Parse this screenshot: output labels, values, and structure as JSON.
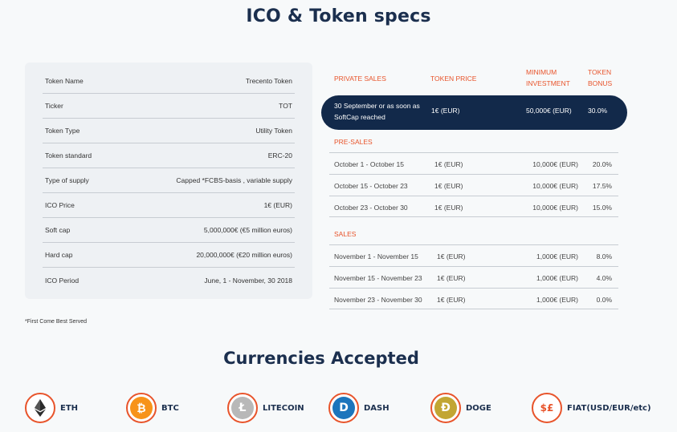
{
  "page": {
    "title": "ICO & Token specs"
  },
  "specs": [
    {
      "label": "Token Name",
      "value": "Trecento Token"
    },
    {
      "label": "Ticker",
      "value": "TOT"
    },
    {
      "label": "Token Type",
      "value": "Utility Token"
    },
    {
      "label": "Token standard",
      "value": "ERC-20"
    },
    {
      "label": "Type of supply",
      "value": "Capped *FCBS-basis , variable supply"
    },
    {
      "label": "ICO Price",
      "value": "1€ (EUR)"
    },
    {
      "label": "Soft cap",
      "value": "5,000,000€ (€5 million euros)"
    },
    {
      "label": "Hard cap",
      "value": "20,000,000€ (€20 million euros)"
    },
    {
      "label": "ICO Period",
      "value": "June, 1 - November, 30 2018"
    }
  ],
  "footnote": "*First Come Best Served",
  "pricing": {
    "headers": {
      "col1": "PRIVATE SALES",
      "col2": "TOKEN PRICE",
      "col3a": "MINIMUM",
      "col3b": "INVESTMENT",
      "col4a": "TOKEN",
      "col4b": "BONUS"
    },
    "private": {
      "period_line1": "30 September or as soon as",
      "period_line2": "SoftCap reached",
      "price": "1€ (EUR)",
      "min": "50,000€ (EUR)",
      "bonus": "30.0%"
    },
    "presales_label": "PRE-SALES",
    "presales": [
      {
        "period": "October 1 - October 15",
        "price": "1€ (EUR)",
        "min": "10,000€ (EUR)",
        "bonus": "20.0%"
      },
      {
        "period": "October 15 - October 23",
        "price": "1€ (EUR)",
        "min": "10,000€ (EUR)",
        "bonus": "17.5%"
      },
      {
        "period": "October 23 - October 30",
        "price": "1€ (EUR)",
        "min": "10,000€ (EUR)",
        "bonus": "15.0%"
      }
    ],
    "sales_label": "SALES",
    "sales": [
      {
        "period": "November 1 - November 15",
        "price": "1€ (EUR)",
        "min": "1,000€ (EUR)",
        "bonus": "8.0%"
      },
      {
        "period": "November 15 - November 23",
        "price": "1€ (EUR)",
        "min": "1,000€ (EUR)",
        "bonus": "4.0%"
      },
      {
        "period": "November 23 - November 30",
        "price": "1€ (EUR)",
        "min": "1,000€ (EUR)",
        "bonus": "0.0%"
      }
    ]
  },
  "currencies": {
    "title": "Currencies Accepted",
    "items": [
      {
        "name": "ETH",
        "icon": "ethereum-icon",
        "glyph": "◆",
        "color": "#2b2b2b"
      },
      {
        "name": "BTC",
        "icon": "bitcoin-icon",
        "glyph": "₿",
        "color": "#f7931a"
      },
      {
        "name": "LITECOIN",
        "icon": "litecoin-icon",
        "glyph": "Ł",
        "color": "#b8b8b8"
      },
      {
        "name": "DASH",
        "icon": "dash-icon",
        "glyph": "D",
        "color": "#1c75bc"
      },
      {
        "name": "DOGE",
        "icon": "dogecoin-icon",
        "glyph": "Ð",
        "color": "#c2a633"
      },
      {
        "name": "FIAT(USD/EUR/etc)",
        "icon": "fiat-currency-icon",
        "glyph": "$£",
        "color": "#e8542b"
      }
    ]
  },
  "colors": {
    "accent": "#e8542b",
    "navy": "#12294a",
    "heading": "#1b2f4e"
  }
}
